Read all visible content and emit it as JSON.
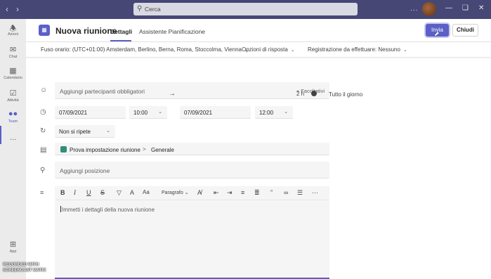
{
  "titlebar": {
    "search_placeholder": "Cerca",
    "more_label": "...",
    "back_icon": "chevron-left-icon",
    "forward_icon": "chevron-right-icon"
  },
  "rail": {
    "items": [
      {
        "label": "Azioni",
        "icon": "bell-icon"
      },
      {
        "label": "Chat",
        "icon": "chat-icon"
      },
      {
        "label": "Calendario",
        "icon": "calendar-icon"
      },
      {
        "label": "Attività",
        "icon": "tasks-icon"
      },
      {
        "label": "Team",
        "icon": "team-icon"
      },
      {
        "label": "...",
        "icon": "more-icon"
      },
      {
        "label": "App",
        "icon": "apps-icon"
      }
    ]
  },
  "header": {
    "title": "Nuova riunione",
    "tabs": [
      {
        "label": "Dettagli",
        "active": true
      },
      {
        "label": "Assistente Pianificazione",
        "active": false
      }
    ],
    "send_label": "Invia",
    "close_label": "Chiudi"
  },
  "options": {
    "timezone": "Fuso orario: (UTC+01:00) Amsterdam, Berlino, Berna, Roma, Stoccolma, Vienna",
    "response": "Opzioni di risposta",
    "recording": "Registrazione da effettuare: Nessuno"
  },
  "form": {
    "attendees_placeholder": "Aggiungi partecipanti obbligatori",
    "optional_label": "+ Facoltativi",
    "start_date": "07/09/2021",
    "start_time": "10:00",
    "end_date": "07/09/2021",
    "end_time": "12:00",
    "duration": "2 h",
    "all_day_label": "Tutto il giorno",
    "repeat": "Non si ripete",
    "channel_team": "Prova impostazione riunione",
    "channel_separator": ">",
    "channel_name": "Generale",
    "location_placeholder": "Aggiungi posizione",
    "paragraph_label": "Paragrafo",
    "details_placeholder": "Immetti i dettagli della nuova riunione"
  },
  "watermark": {
    "line1": "RECORDED WITH",
    "line2": "SCREENCAST MATIC"
  },
  "colors": {
    "titlebar": "#464775",
    "accent": "#5b5fc7",
    "channel_badge": "#2f8f7a"
  }
}
